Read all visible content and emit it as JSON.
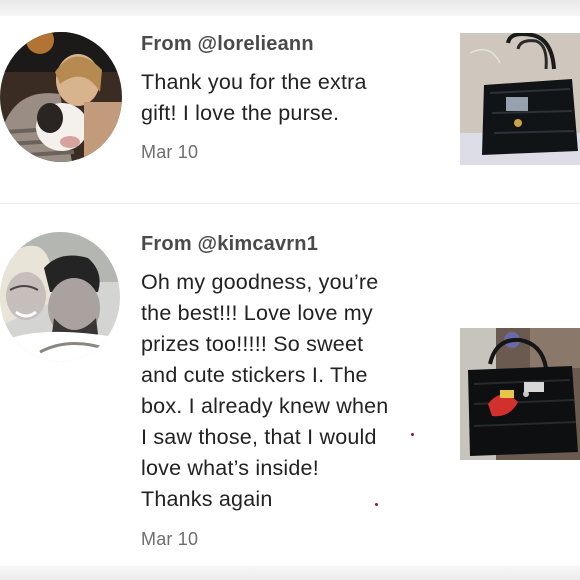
{
  "reviews": [
    {
      "username": "From @lorelieann",
      "message_lines": [
        "Thank you for the extra",
        "gift! I love the purse."
      ],
      "date": "Mar 10"
    },
    {
      "username": "From @kimcavrn1",
      "message_lines": [
        "Oh my goodness, you’re",
        "the best!!! Love love my",
        "prizes too!!!!! So sweet",
        "and cute stickers I. The",
        "box. I already knew when",
        "I saw those, that I would",
        "love what’s inside!",
        "Thanks again"
      ],
      "date": "Mar 10"
    }
  ],
  "colors": {
    "username": "#4a4a4a",
    "message": "#222222",
    "date": "#6e6e6e",
    "divider": "#ececec"
  }
}
